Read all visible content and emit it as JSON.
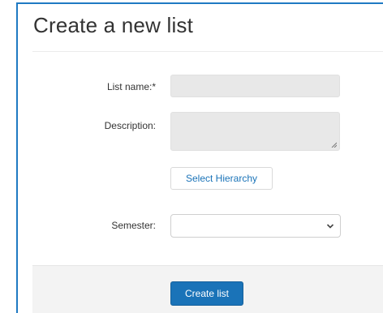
{
  "form": {
    "title": "Create a new list",
    "list_name_label": "List name:*",
    "list_name_value": "",
    "description_label": "Description:",
    "description_value": "",
    "select_hierarchy_label": "Select Hierarchy",
    "semester_label": "Semester:",
    "semester_value": "",
    "create_button_label": "Create list"
  },
  "colors": {
    "accent": "#1a73b8",
    "panel_border": "#1f7ac3",
    "input_fill": "#e8e8e8",
    "footer_fill": "#f3f3f3"
  },
  "icons": {
    "semester_dropdown": "chevron-down-icon",
    "description_resize": "resize-grip-icon"
  }
}
